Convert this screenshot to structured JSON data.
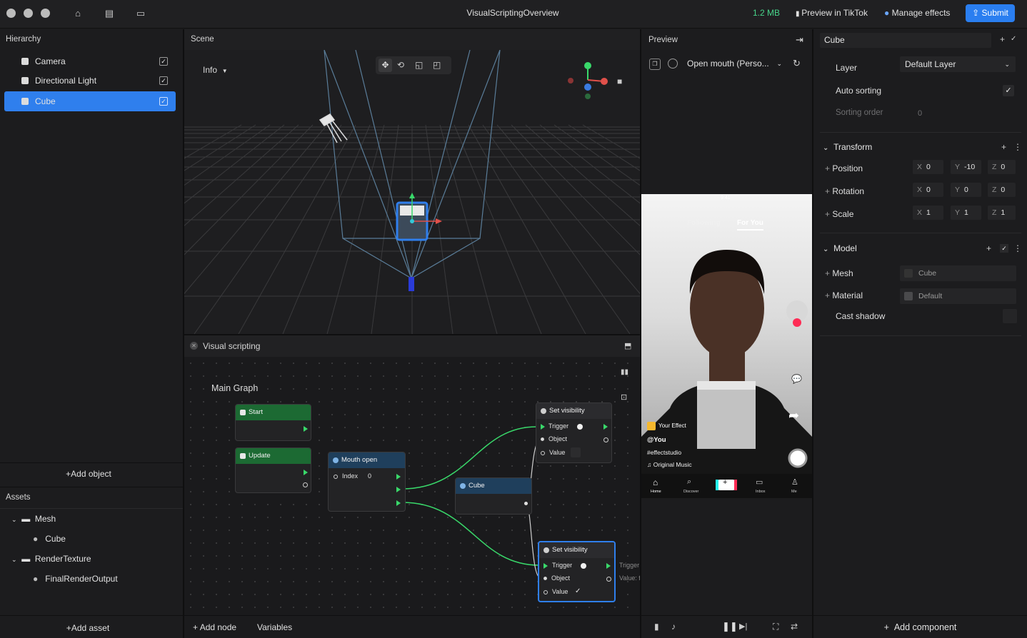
{
  "titlebar": {
    "title": "VisualScriptingOverview",
    "size": "1.2 MB",
    "preview_link": "Preview in TikTok",
    "manage_link": "Manage effects",
    "submit": "Submit"
  },
  "hierarchy": {
    "title": "Hierarchy",
    "items": [
      {
        "label": "Camera",
        "checked": true,
        "selected": false
      },
      {
        "label": "Directional Light",
        "checked": true,
        "selected": false
      },
      {
        "label": "Cube",
        "checked": true,
        "selected": true
      }
    ],
    "add_object": "Add object"
  },
  "assets": {
    "title": "Assets",
    "folders": [
      {
        "label": "Mesh",
        "children": [
          "Cube"
        ]
      },
      {
        "label": "RenderTexture",
        "children": [
          "FinalRenderOutput"
        ]
      }
    ],
    "add_asset": "Add asset"
  },
  "scene": {
    "title": "Scene",
    "info": "Info"
  },
  "visual_scripting": {
    "title": "Visual scripting",
    "graph_title": "Main Graph",
    "nodes": {
      "start": "Start",
      "update": "Update",
      "mouth_open": "Mouth open",
      "index_label": "Index",
      "index_value": "0",
      "cube": "Cube",
      "setvis1": "Set visibility",
      "setvis2": "Set visibility",
      "trigger": "Trigger",
      "object": "Object",
      "value": "Value",
      "overflow_trigger": "Trigger",
      "overflow_value": "Value: f"
    },
    "add_node": "Add node",
    "variables": "Variables"
  },
  "preview": {
    "title": "Preview",
    "dropdown": "Open mouth (Perso...",
    "phone": {
      "time": "9:41",
      "tab_following": "Following",
      "tab_foryou": "For You",
      "effect": "Your Effect",
      "user": "@You",
      "hashtag": "#effectstudio",
      "music": "Original Music",
      "nav": [
        "Home",
        "Discover",
        "",
        "Inbox",
        "Me"
      ]
    }
  },
  "inspector": {
    "object_name": "Cube",
    "layer_label": "Layer",
    "layer_value": "Default Layer",
    "auto_sorting": "Auto sorting",
    "sorting_order_label": "Sorting order",
    "sorting_order_value": "0",
    "transform": "Transform",
    "position": {
      "label": "Position",
      "x": "0",
      "y": "-10",
      "z": "0"
    },
    "rotation": {
      "label": "Rotation",
      "x": "0",
      "y": "0",
      "z": "0"
    },
    "scale": {
      "label": "Scale",
      "x": "1",
      "y": "1",
      "z": "1"
    },
    "model": "Model",
    "mesh_label": "Mesh",
    "mesh_value": "Cube",
    "material_label": "Material",
    "material_value": "Default",
    "cast_shadow": "Cast shadow",
    "add_component": "Add component"
  },
  "colors": {
    "accent": "#2f7fed",
    "green": "#47d48a",
    "node_green": "#1c6a33",
    "node_blue": "#1f3f5c"
  }
}
